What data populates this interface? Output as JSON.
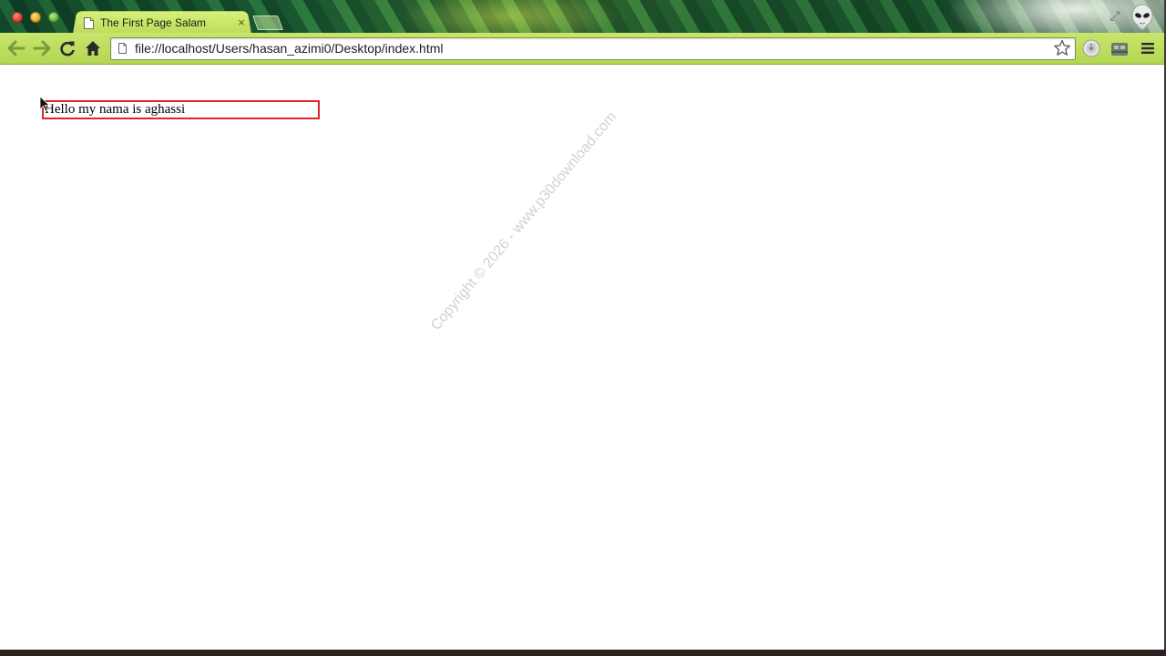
{
  "window": {
    "tab": {
      "title": "The First Page Salam",
      "close_glyph": "×"
    },
    "restore_glyph": "⤢"
  },
  "toolbar": {
    "back_icon": "back-arrow-icon",
    "forward_icon": "forward-arrow-icon",
    "reload_icon": "reload-icon",
    "home_icon": "home-icon",
    "url": "file://localhost/Users/hasan_azimi0/Desktop/index.html",
    "extensions": [
      "extension-shield-icon",
      "extension-puzzle-icon"
    ],
    "menu_icon": "hamburger-menu-icon"
  },
  "page": {
    "text": "Hello my nama is aghassi",
    "box_border_color": "#e0242a",
    "watermark": "Copyright © 2026 - www.p30download.com"
  },
  "colors": {
    "toolbar": "#c8e56c",
    "tab_active": "#d9f07a"
  }
}
